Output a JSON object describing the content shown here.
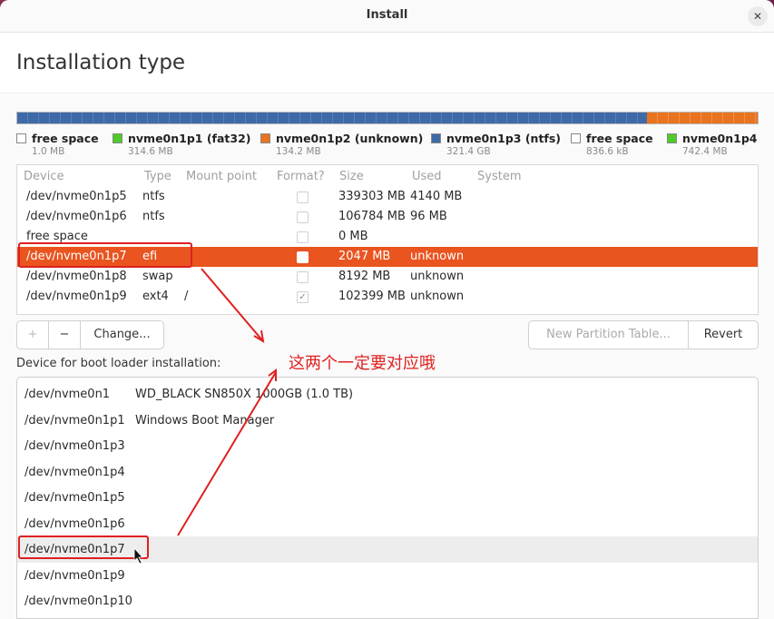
{
  "window": {
    "title": "Install",
    "close_glyph": "✕"
  },
  "page_title": "Installation type",
  "colors": {
    "selected_row": "#e9541f",
    "ntfs": "#3f6aa8",
    "fat32": "#4ecb2a",
    "unknown": "#e9731f",
    "free": "#ffffff",
    "annotation": "#e02020"
  },
  "legend": [
    {
      "name": "free space",
      "size": "1.0 MB",
      "color": "#ffffff"
    },
    {
      "name": "nvme0n1p1 (fat32)",
      "size": "314.6 MB",
      "color": "#4ecb2a"
    },
    {
      "name": "nvme0n1p2 (unknown)",
      "size": "134.2 MB",
      "color": "#e9731f"
    },
    {
      "name": "nvme0n1p3 (ntfs)",
      "size": "321.4 GB",
      "color": "#3f6aa8"
    },
    {
      "name": "free space",
      "size": "836.6 kB",
      "color": "#ffffff"
    },
    {
      "name": "nvme0n1p4",
      "size": "742.4 MB",
      "color": "#4ecb2a"
    }
  ],
  "table": {
    "headers": {
      "device": "Device",
      "type": "Type",
      "mount": "Mount point",
      "format": "Format?",
      "size": "Size",
      "used": "Used",
      "system": "System"
    },
    "rows": [
      {
        "device": "/dev/nvme0n1p5",
        "type": "ntfs",
        "mount": "",
        "format": "",
        "size": "339303 MB",
        "used": "4140 MB"
      },
      {
        "device": "/dev/nvme0n1p6",
        "type": "ntfs",
        "mount": "",
        "format": "",
        "size": "106784 MB",
        "used": "96 MB"
      },
      {
        "device": "free space",
        "type": "",
        "mount": "",
        "format": "",
        "size": "0 MB",
        "used": ""
      },
      {
        "device": "/dev/nvme0n1p7",
        "type": "efi",
        "mount": "",
        "format": "",
        "size": "2047 MB",
        "used": "unknown"
      },
      {
        "device": "/dev/nvme0n1p8",
        "type": "swap",
        "mount": "",
        "format": "",
        "size": "8192 MB",
        "used": "unknown"
      },
      {
        "device": "/dev/nvme0n1p9",
        "type": "ext4",
        "mount": "/",
        "format": "✓",
        "size": "102399 MB",
        "used": "unknown"
      }
    ]
  },
  "toolbar": {
    "add": "+",
    "remove": "−",
    "change": "Change...",
    "new_table": "New Partition Table...",
    "revert": "Revert"
  },
  "boot_label": "Device for boot loader installation:",
  "boot_devices": [
    {
      "device": "/dev/nvme0n1",
      "desc": "WD_BLACK SN850X 1000GB (1.0 TB)"
    },
    {
      "device": "/dev/nvme0n1p1",
      "desc": "Windows Boot Manager"
    },
    {
      "device": "/dev/nvme0n1p3",
      "desc": ""
    },
    {
      "device": "/dev/nvme0n1p4",
      "desc": ""
    },
    {
      "device": "/dev/nvme0n1p5",
      "desc": ""
    },
    {
      "device": "/dev/nvme0n1p6",
      "desc": ""
    },
    {
      "device": "/dev/nvme0n1p7",
      "desc": ""
    },
    {
      "device": "/dev/nvme0n1p9",
      "desc": ""
    },
    {
      "device": "/dev/nvme0n1p10",
      "desc": ""
    }
  ],
  "annotation": {
    "text": "这两个一定要对应哦"
  }
}
